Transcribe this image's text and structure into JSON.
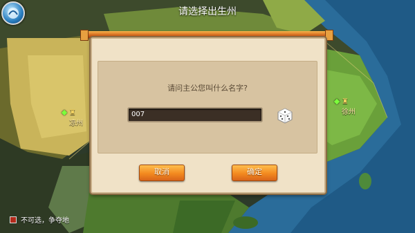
{
  "header": {
    "title": "请选择出生州"
  },
  "map": {
    "cities": [
      {
        "name": "凉州"
      },
      {
        "name": "徐州"
      }
    ],
    "legend": {
      "label": "不可选，争夺地",
      "color": "#b32b1b"
    }
  },
  "dialog": {
    "question": "请问主公您叫什么名字?",
    "name_input": {
      "value": "007"
    },
    "dice_icon": "dice-icon",
    "cancel_label": "取消",
    "ok_label": "确定",
    "accent": "#f38a1f"
  }
}
